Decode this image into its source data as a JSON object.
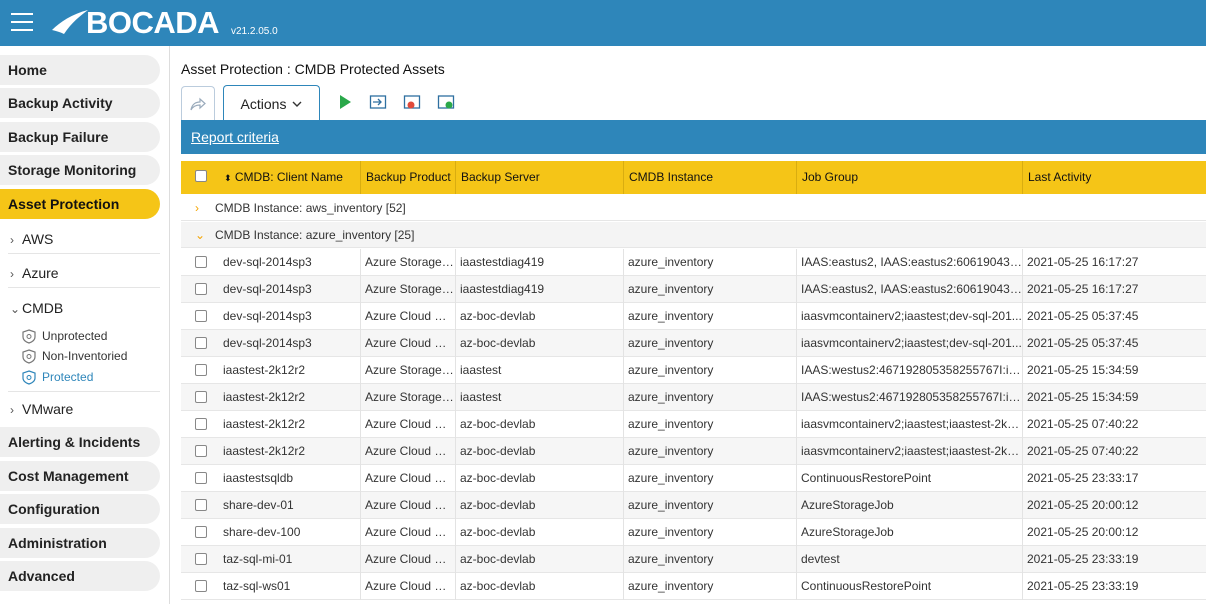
{
  "app": {
    "logo": "BOCADA",
    "version": "v21.2.05.0"
  },
  "sidebar": {
    "items": [
      {
        "label": "Home"
      },
      {
        "label": "Backup Activity"
      },
      {
        "label": "Backup Failure"
      },
      {
        "label": "Storage Monitoring"
      },
      {
        "label": "Asset Protection",
        "active": true
      }
    ],
    "subs": [
      {
        "label": "AWS"
      },
      {
        "label": "Azure"
      },
      {
        "label": "CMDB"
      },
      {
        "label": "VMware"
      }
    ],
    "leaves": [
      {
        "label": "Unprotected"
      },
      {
        "label": "Non-Inventoried"
      },
      {
        "label": "Protected",
        "active": true
      }
    ],
    "bottom": [
      {
        "label": "Alerting & Incidents"
      },
      {
        "label": "Cost Management"
      },
      {
        "label": "Configuration"
      },
      {
        "label": "Administration"
      },
      {
        "label": "Advanced"
      }
    ]
  },
  "main": {
    "title": "Asset Protection : CMDB Protected Assets",
    "actions_label": "Actions",
    "report_link": "Report criteria"
  },
  "grid": {
    "columns": [
      "CMDB: Client Name",
      "Backup Product",
      "Backup Server",
      "CMDB Instance",
      "Job Group",
      "Last Activity"
    ],
    "groups": [
      {
        "label": "CMDB Instance: aws_inventory [52]"
      },
      {
        "label": "CMDB Instance: azure_inventory [25]"
      }
    ],
    "rows": [
      [
        "dev-sql-2014sp3",
        "Azure Storage ...",
        "iaastestdiag419",
        "azure_inventory",
        "IAAS:eastus2, IAAS:eastus2:6061904374...",
        "2021-05-25 16:17:27"
      ],
      [
        "dev-sql-2014sp3",
        "Azure Storage ...",
        "iaastestdiag419",
        "azure_inventory",
        "IAAS:eastus2, IAAS:eastus2:6061904374...",
        "2021-05-25 16:17:27"
      ],
      [
        "dev-sql-2014sp3",
        "Azure Cloud Re...",
        "az-boc-devlab",
        "azure_inventory",
        "iaasvmcontainerv2;iaastest;dev-sql-201...",
        "2021-05-25 05:37:45"
      ],
      [
        "dev-sql-2014sp3",
        "Azure Cloud Re...",
        "az-boc-devlab",
        "azure_inventory",
        "iaasvmcontainerv2;iaastest;dev-sql-201...",
        "2021-05-25 05:37:45"
      ],
      [
        "iaastest-2k12r2",
        "Azure Storage ...",
        "iaastest",
        "azure_inventory",
        "IAAS:westus2:467192805358255767I:iaa...",
        "2021-05-25 15:34:59"
      ],
      [
        "iaastest-2k12r2",
        "Azure Storage ...",
        "iaastest",
        "azure_inventory",
        "IAAS:westus2:467192805358255767I:iaa...",
        "2021-05-25 15:34:59"
      ],
      [
        "iaastest-2k12r2",
        "Azure Cloud Re...",
        "az-boc-devlab",
        "azure_inventory",
        "iaasvmcontainerv2;iaastest;iaastest-2k1...",
        "2021-05-25 07:40:22"
      ],
      [
        "iaastest-2k12r2",
        "Azure Cloud Re...",
        "az-boc-devlab",
        "azure_inventory",
        "iaasvmcontainerv2;iaastest;iaastest-2k1...",
        "2021-05-25 07:40:22"
      ],
      [
        "iaastestsqldb",
        "Azure Cloud Re...",
        "az-boc-devlab",
        "azure_inventory",
        "ContinuousRestorePoint",
        "2021-05-25 23:33:17"
      ],
      [
        "share-dev-01",
        "Azure Cloud Re...",
        "az-boc-devlab",
        "azure_inventory",
        "AzureStorageJob",
        "2021-05-25 20:00:12"
      ],
      [
        "share-dev-100",
        "Azure Cloud Re...",
        "az-boc-devlab",
        "azure_inventory",
        "AzureStorageJob",
        "2021-05-25 20:00:12"
      ],
      [
        "taz-sql-mi-01",
        "Azure Cloud Re...",
        "az-boc-devlab",
        "azure_inventory",
        "devtest",
        "2021-05-25 23:33:19"
      ],
      [
        "taz-sql-ws01",
        "Azure Cloud Re...",
        "az-boc-devlab",
        "azure_inventory",
        "ContinuousRestorePoint",
        "2021-05-25 23:33:19"
      ]
    ]
  },
  "colors": {
    "brand": "#2e86ba",
    "accent": "#f5c517"
  },
  "icons": [
    "hamburger-icon",
    "share-icon",
    "chevron-down-icon",
    "play-icon",
    "export-icon",
    "remove-icon",
    "add-icon",
    "shield-icon"
  ]
}
